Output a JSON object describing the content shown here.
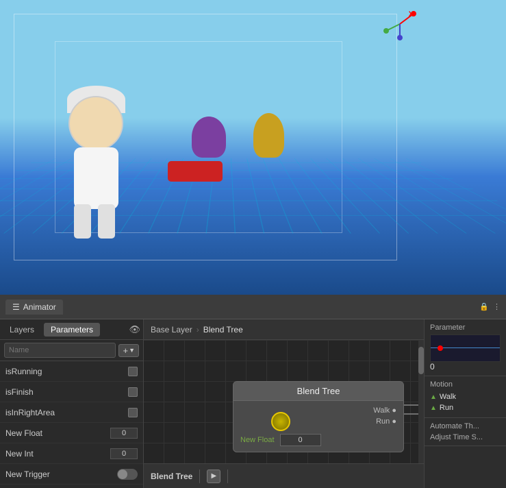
{
  "viewport": {
    "label": "3D Viewport"
  },
  "animator": {
    "title": "Animator",
    "tabs": {
      "layers": "Layers",
      "parameters": "Parameters"
    },
    "search_placeholder": "Name",
    "breadcrumb": {
      "base_layer": "Base Layer",
      "blend_tree": "Blend Tree"
    },
    "parameters": [
      {
        "name": "isRunning",
        "type": "bool",
        "value": "false"
      },
      {
        "name": "isFinish",
        "type": "bool",
        "value": "false"
      },
      {
        "name": "isInRightArea",
        "type": "bool",
        "value": "false"
      },
      {
        "name": "New Float",
        "type": "float",
        "value": "0"
      },
      {
        "name": "New Int",
        "type": "int",
        "value": "0"
      },
      {
        "name": "New Trigger",
        "type": "trigger",
        "value": ""
      }
    ],
    "blend_tree_node": {
      "title": "Blend Tree",
      "outputs": [
        {
          "label": "Walk"
        },
        {
          "label": "Run"
        }
      ],
      "new_float_label": "New Float",
      "input_value": "0"
    }
  },
  "right_panel": {
    "parameter_title": "Parameter",
    "parameter_value": "0",
    "motion_title": "Motion",
    "motion_items": [
      {
        "name": "Walk"
      },
      {
        "name": "Run"
      }
    ],
    "automate_threshold": "Automate Th...",
    "adjust_time": "Adjust Time S..."
  },
  "bottom_bar": {
    "blend_tree_label": "Blend Tree",
    "play_icon": "▶",
    "separator_icon": "|"
  },
  "icons": {
    "lock": "🔒",
    "menu": "⋮",
    "eye": "👁",
    "add": "+",
    "chevron": "▼",
    "play": "▶"
  }
}
